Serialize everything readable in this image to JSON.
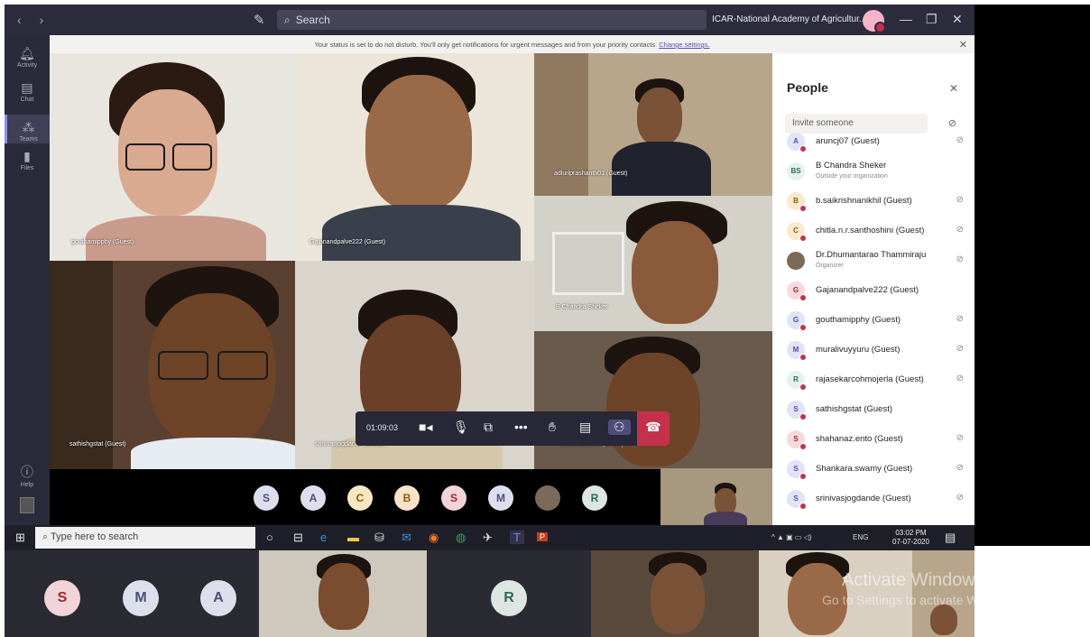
{
  "titlebar": {
    "search_placeholder": "Search",
    "org_name": "ICAR-National Academy of Agricultur...",
    "nav": "‹  ›"
  },
  "rail": {
    "items": [
      {
        "label": "Activity",
        "icon": "bell-icon"
      },
      {
        "label": "Chat",
        "icon": "chat-icon"
      },
      {
        "label": "Teams",
        "icon": "teams-icon"
      },
      {
        "label": "Files",
        "icon": "files-icon"
      }
    ],
    "help_label": "Help"
  },
  "notice": {
    "text": "Your status is set to do not disturb. You'll only get notifications for urgent messages and from your priority contacts.",
    "link": "Change settings."
  },
  "videos": [
    {
      "label": "gouthamipphy (Guest)"
    },
    {
      "label": "Gajanandpalve222 (Guest)"
    },
    {
      "label": "adluriprashanth01 (Guest)"
    },
    {
      "label": "B Chandra Sheker"
    },
    {
      "label": "sathishgstat (Guest)"
    },
    {
      "label": "srinivasjogdande (Guest)"
    },
    {
      "label": "shahanaz.ento (Guest)"
    }
  ],
  "controls": {
    "timer": "01:09:03"
  },
  "people": {
    "title": "People",
    "invite_placeholder": "Invite someone",
    "list": [
      {
        "initials": "A",
        "name": "aruncj07 (Guest)",
        "sub": "",
        "bg": "#e1e3f6",
        "fg": "#4f52b2",
        "muted": true
      },
      {
        "initials": "BS",
        "name": "B Chandra Sheker",
        "sub": "Outside your organization",
        "bg": "#e6f2ee",
        "fg": "#2a6a5b",
        "muted": false
      },
      {
        "initials": "B",
        "name": "b.saikrishnanikhil (Guest)",
        "sub": "",
        "bg": "#fbe9cf",
        "fg": "#8a5a00",
        "muted": true
      },
      {
        "initials": "C",
        "name": "chitla.n.r.santhoshini (Guest)",
        "sub": "",
        "bg": "#fbe9cf",
        "fg": "#8a5a00",
        "muted": true
      },
      {
        "initials": "",
        "name": "Dr.Dhumantarao Thammiraju",
        "sub": "Organizer",
        "bg": "#7a6a5a",
        "fg": "#fff",
        "muted": true
      },
      {
        "initials": "G",
        "name": "Gajanandpalve222 (Guest)",
        "sub": "",
        "bg": "#f6d9dc",
        "fg": "#a4262c",
        "muted": false
      },
      {
        "initials": "G",
        "name": "gouthamipphy (Guest)",
        "sub": "",
        "bg": "#e1e3f6",
        "fg": "#4f52b2",
        "muted": true
      },
      {
        "initials": "M",
        "name": "muralivuyyuru (Guest)",
        "sub": "",
        "bg": "#e1e3f6",
        "fg": "#4f52b2",
        "muted": true
      },
      {
        "initials": "R",
        "name": "rajasekarcohmojerla (Guest)",
        "sub": "",
        "bg": "#e6f2ee",
        "fg": "#2a6a5b",
        "muted": true
      },
      {
        "initials": "S",
        "name": "sathishgstat (Guest)",
        "sub": "",
        "bg": "#e1e3f6",
        "fg": "#4f52b2",
        "muted": false
      },
      {
        "initials": "S",
        "name": "shahanaz.ento (Guest)",
        "sub": "",
        "bg": "#f6d9dc",
        "fg": "#a4262c",
        "muted": true
      },
      {
        "initials": "S",
        "name": "Shankara.swamy (Guest)",
        "sub": "",
        "bg": "#e1e3f6",
        "fg": "#4f52b2",
        "muted": true
      },
      {
        "initials": "S",
        "name": "srinivasjogdande (Guest)",
        "sub": "",
        "bg": "#e1e3f6",
        "fg": "#4f52b2",
        "muted": true
      }
    ]
  },
  "roster": [
    {
      "initials": "S",
      "bg": "#dde0ec",
      "fg": "#4b4f7a"
    },
    {
      "initials": "A",
      "bg": "#dde0ec",
      "fg": "#4b4f7a"
    },
    {
      "initials": "C",
      "bg": "#f8e8c2",
      "fg": "#8a5a00"
    },
    {
      "initials": "B",
      "bg": "#f8e3c8",
      "fg": "#8a5a00"
    },
    {
      "initials": "S",
      "bg": "#f2d4d8",
      "fg": "#a4262c"
    },
    {
      "initials": "M",
      "bg": "#dde0ec",
      "fg": "#4b4f7a"
    },
    {
      "initials": "",
      "bg": "#7a6a5a",
      "fg": "#fff"
    },
    {
      "initials": "R",
      "bg": "#dde6e2",
      "fg": "#2a6a5b"
    }
  ],
  "taskbar": {
    "search_placeholder": "Type here to search",
    "lang": "ENG",
    "time": "03:02 PM",
    "date": "07-07-2020"
  },
  "strip": {
    "avatars": [
      {
        "initials": "S",
        "bg": "#f2d4d8",
        "fg": "#a4262c"
      },
      {
        "initials": "M",
        "bg": "#dde0ec",
        "fg": "#4b4f7a"
      },
      {
        "initials": "A",
        "bg": "#dde0ec",
        "fg": "#4b4f7a"
      },
      {
        "initials": "R",
        "bg": "#dde6e2",
        "fg": "#2a6a5b"
      }
    ],
    "watermark_title": "Activate Windows",
    "watermark_sub": "Go to Settings to activate Windows."
  }
}
